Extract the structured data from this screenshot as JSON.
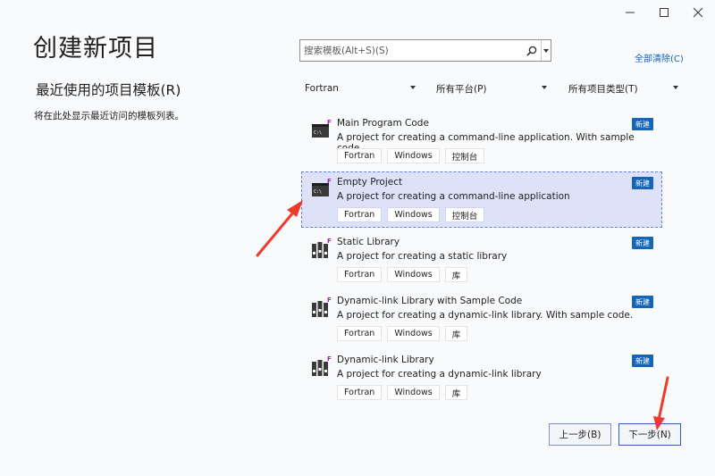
{
  "header": {
    "title": "创建新项目"
  },
  "window_controls": {
    "minimize_icon": "minimize-icon",
    "maximize_icon": "maximize-icon",
    "close_icon": "close-icon"
  },
  "recent": {
    "title": "最近使用的项目模板(R)",
    "empty_text": "将在此处显示最近访问的模板列表。"
  },
  "search": {
    "placeholder": "搜索模板(Alt+S)(S)",
    "value": ""
  },
  "clear_all_label": "全部清除(C)",
  "filters": {
    "language": "Fortran",
    "platform": "所有平台(P)",
    "project_type": "所有项目类型(T)"
  },
  "templates": [
    {
      "name": "Main Program Code",
      "description": "A project for creating a command-line application. With sample code.",
      "tags": [
        "Fortran",
        "Windows",
        "控制台"
      ],
      "badge": "新建",
      "icon": "console-app-icon",
      "selected": false
    },
    {
      "name": "Empty Project",
      "description": "A project for creating a command-line application",
      "tags": [
        "Fortran",
        "Windows",
        "控制台"
      ],
      "badge": "新建",
      "icon": "console-app-icon",
      "selected": true
    },
    {
      "name": "Static Library",
      "description": "A project for creating a static library",
      "tags": [
        "Fortran",
        "Windows",
        "库"
      ],
      "badge": "新建",
      "icon": "library-icon",
      "selected": false
    },
    {
      "name": "Dynamic-link Library with Sample Code",
      "description": "A project for creating a dynamic-link library. With sample code.",
      "tags": [
        "Fortran",
        "Windows",
        "库"
      ],
      "badge": "新建",
      "icon": "library-icon",
      "selected": false
    },
    {
      "name": "Dynamic-link Library",
      "description": "A project for creating a dynamic-link library",
      "tags": [
        "Fortran",
        "Windows",
        "库"
      ],
      "badge": "新建",
      "icon": "library-icon",
      "selected": false
    }
  ],
  "footer": {
    "back_label": "上一步(B)",
    "next_label": "下一步(N)"
  },
  "colors": {
    "accent": "#1565b8",
    "selected_bg": "#dde2f8",
    "annotation_arrow": "#ee3a2d"
  }
}
